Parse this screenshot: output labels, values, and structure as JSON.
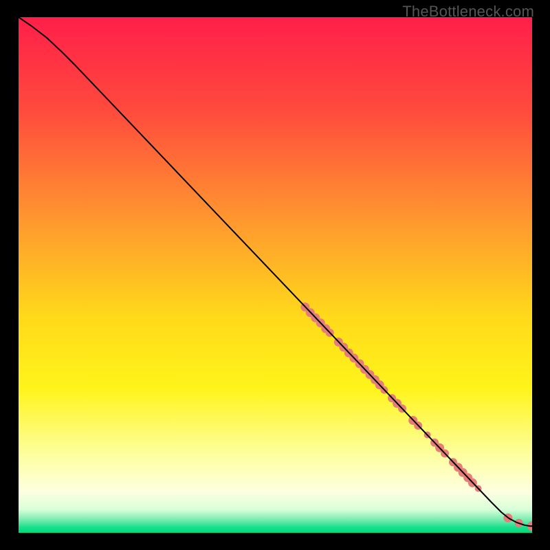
{
  "watermark": "TheBottleneck.com",
  "chart_data": {
    "type": "line",
    "title": "",
    "xlabel": "",
    "ylabel": "",
    "xlim": [
      0,
      100
    ],
    "ylim": [
      0,
      100
    ],
    "grid": false,
    "legend": false,
    "gradient_stops": [
      {
        "offset": 0,
        "color": "#ff1f49"
      },
      {
        "offset": 0.18,
        "color": "#ff4a3d"
      },
      {
        "offset": 0.4,
        "color": "#ff9a2e"
      },
      {
        "offset": 0.58,
        "color": "#ffd91a"
      },
      {
        "offset": 0.72,
        "color": "#fff41a"
      },
      {
        "offset": 0.85,
        "color": "#fdffa0"
      },
      {
        "offset": 0.92,
        "color": "#fdffe0"
      },
      {
        "offset": 0.955,
        "color": "#d8ffd8"
      },
      {
        "offset": 0.975,
        "color": "#76ecb0"
      },
      {
        "offset": 0.99,
        "color": "#14e08a"
      },
      {
        "offset": 1.0,
        "color": "#00d97e"
      }
    ],
    "series": [
      {
        "name": "curve",
        "type": "line",
        "color": "#000000",
        "x": [
          0.0,
          2.5,
          5.5,
          8.5,
          11.0,
          92.0,
          94.0,
          95.5,
          97.0,
          98.5,
          99.6,
          100.0
        ],
        "y": [
          100.0,
          98.3,
          96.0,
          93.2,
          90.7,
          6.0,
          4.0,
          2.8,
          2.0,
          1.5,
          1.3,
          1.3
        ]
      },
      {
        "name": "points",
        "type": "scatter",
        "color": "#e77d78",
        "points": [
          {
            "x": 55.8,
            "y": 43.8,
            "r": 6.5
          },
          {
            "x": 56.8,
            "y": 42.7,
            "r": 6.5
          },
          {
            "x": 57.8,
            "y": 41.7,
            "r": 6.5
          },
          {
            "x": 58.8,
            "y": 40.7,
            "r": 6.5
          },
          {
            "x": 59.8,
            "y": 39.6,
            "r": 6.5
          },
          {
            "x": 60.6,
            "y": 38.8,
            "r": 6.0
          },
          {
            "x": 62.3,
            "y": 37.0,
            "r": 6.5
          },
          {
            "x": 63.3,
            "y": 36.0,
            "r": 6.5
          },
          {
            "x": 64.3,
            "y": 34.9,
            "r": 6.5
          },
          {
            "x": 65.3,
            "y": 33.9,
            "r": 6.5
          },
          {
            "x": 66.4,
            "y": 32.8,
            "r": 6.5
          },
          {
            "x": 67.4,
            "y": 31.7,
            "r": 6.5
          },
          {
            "x": 68.4,
            "y": 30.7,
            "r": 6.5
          },
          {
            "x": 69.4,
            "y": 29.7,
            "r": 6.5
          },
          {
            "x": 70.3,
            "y": 28.7,
            "r": 6.5
          },
          {
            "x": 71.2,
            "y": 27.7,
            "r": 5.5
          },
          {
            "x": 72.7,
            "y": 26.1,
            "r": 6.0
          },
          {
            "x": 73.7,
            "y": 25.1,
            "r": 6.5
          },
          {
            "x": 74.7,
            "y": 24.1,
            "r": 6.0
          },
          {
            "x": 76.8,
            "y": 21.8,
            "r": 6.5
          },
          {
            "x": 77.8,
            "y": 20.8,
            "r": 6.0
          },
          {
            "x": 79.6,
            "y": 19.0,
            "r": 5.0
          },
          {
            "x": 81.0,
            "y": 17.5,
            "r": 6.0
          },
          {
            "x": 82.0,
            "y": 16.5,
            "r": 6.5
          },
          {
            "x": 83.0,
            "y": 15.4,
            "r": 6.0
          },
          {
            "x": 84.6,
            "y": 13.7,
            "r": 6.0
          },
          {
            "x": 85.6,
            "y": 12.7,
            "r": 6.5
          },
          {
            "x": 86.5,
            "y": 11.7,
            "r": 6.5
          },
          {
            "x": 87.5,
            "y": 10.7,
            "r": 6.5
          },
          {
            "x": 88.4,
            "y": 9.7,
            "r": 6.5
          },
          {
            "x": 89.5,
            "y": 8.6,
            "r": 5.0
          },
          {
            "x": 95.3,
            "y": 2.9,
            "r": 6.5
          },
          {
            "x": 97.4,
            "y": 1.9,
            "r": 6.0
          },
          {
            "x": 100.0,
            "y": 1.3,
            "r": 7.0
          },
          {
            "x": 101.5,
            "y": 1.3,
            "r": 7.0
          }
        ]
      }
    ]
  }
}
